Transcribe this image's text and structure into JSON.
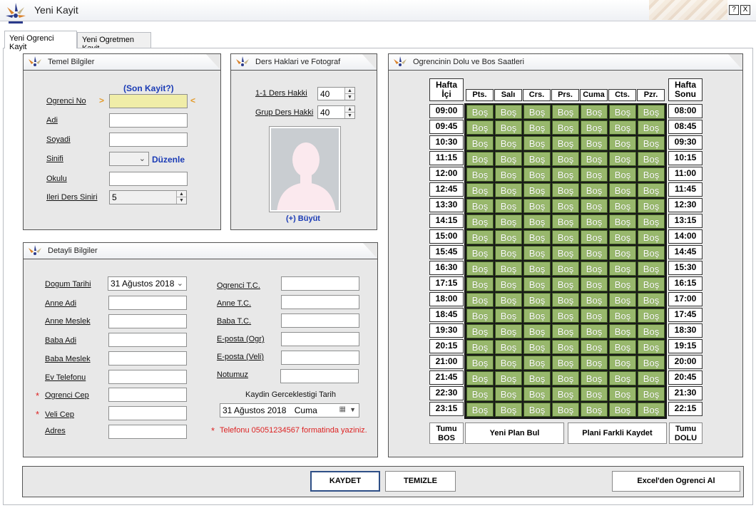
{
  "window": {
    "title": "Yeni Kayit",
    "help_btn": "?",
    "close_btn": "X"
  },
  "tabs": [
    {
      "label": "Yeni Ogrenci Kayit"
    },
    {
      "label": "Yeni Ogretmen Kayit"
    }
  ],
  "temel": {
    "title": "Temel Bilgiler",
    "son_kayit": "(Son Kayit?)",
    "ogrenci_no": "Ogrenci No",
    "adi": "Adi",
    "soyadi": "Soyadi",
    "sinifi": "Sinifi",
    "duzenle": "Düzenle",
    "okulu": "Okulu",
    "ileri_ders": "Ileri Ders Siniri",
    "ileri_ders_val": "5",
    "arrow_left": ">",
    "arrow_right": "<"
  },
  "ders": {
    "title": "Ders Haklari ve Fotograf",
    "birebir": "1-1 Ders Hakki",
    "birebir_val": "40",
    "grup": "Grup Ders Hakki",
    "grup_val": "40",
    "buyut": "(+) Büyüt"
  },
  "detay": {
    "title": "Detayli Bilgiler",
    "dogum_tarihi": "Dogum Tarihi",
    "dogum_val": "31 Ağustos 2018",
    "anne_adi": "Anne Adi",
    "anne_meslek": "Anne Meslek",
    "baba_adi": "Baba Adi",
    "baba_meslek": "Baba Meslek",
    "ev_telefonu": "Ev Telefonu",
    "ogrenci_cep": "Ogrenci Cep",
    "veli_cep": "Veli Cep",
    "adres": "Adres",
    "ogrenci_tc": "Ogrenci T.C.",
    "anne_tc": "Anne T.C.",
    "baba_tc": "Baba T.C.",
    "eposta_ogr": "E-posta  (Ogr)",
    "eposta_veli": "E-posta (Veli)",
    "notumuz": "Notumuz",
    "kayit_tarih_label": "Kaydin Gerceklestigi Tarih",
    "kayit_tarih_val": "31 Ağustos 2018",
    "kayit_gun": "Cuma",
    "star": "*",
    "telefon_note": "Telefonu 05051234567 formatinda yaziniz."
  },
  "schedule": {
    "title": "Ogrencinin Dolu ve Bos Saatleri",
    "hafta_ici": "Hafta İçi",
    "hafta_sonu": "Hafta Sonu",
    "days": [
      "Pts.",
      "Salı",
      "Crs.",
      "Prs.",
      "Cuma",
      "Cts.",
      "Pzr."
    ],
    "weekday_times": [
      "09:00",
      "09:45",
      "10:30",
      "11:15",
      "12:00",
      "12:45",
      "13:30",
      "14:15",
      "15:00",
      "15:45",
      "16:30",
      "17:15",
      "18:00",
      "18:45",
      "19:30",
      "20:15",
      "21:00",
      "21:45",
      "22:30",
      "23:15"
    ],
    "weekend_times": [
      "08:00",
      "08:45",
      "09:30",
      "10:15",
      "11:00",
      "11:45",
      "12:30",
      "13:15",
      "14:00",
      "14:45",
      "15:30",
      "16:15",
      "17:00",
      "17:45",
      "18:30",
      "19:15",
      "20:00",
      "20:45",
      "21:30",
      "22:15"
    ],
    "slot_label": "Boş",
    "slot_color": "#98b86c",
    "tumu_bos": "Tumu BOS",
    "tumu_dolu": "Tumu DOLU",
    "yeni_plan": "Yeni Plan Bul",
    "plani_farkli": "Plani Farkli Kaydet"
  },
  "footer": {
    "kaydet": "KAYDET",
    "temizle": "TEMIZLE",
    "excel": "Excel'den Ogrenci Al"
  }
}
